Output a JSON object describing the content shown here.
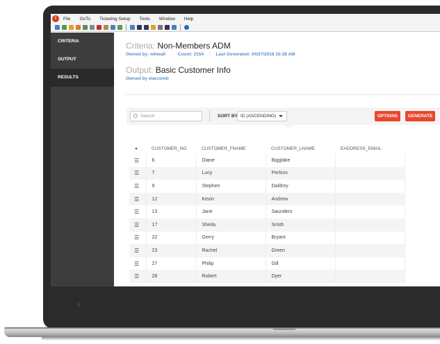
{
  "menu": [
    "File",
    "GoTo",
    "Ticketing Setup",
    "Tools",
    "Window",
    "Help"
  ],
  "logo_letter": "t",
  "sidebar": [
    {
      "label": "CRITERIA"
    },
    {
      "label": "OUTPUT"
    },
    {
      "label": "RESULTS",
      "active": true
    }
  ],
  "criteria": {
    "label": "Criteria:",
    "name": "Non-Members ADM",
    "owner": "Owned by: mhwall",
    "count": "Count: 2154",
    "last_generated": "Last Generated: 04/27/2018 10:28 AM"
  },
  "output": {
    "label": "Output:",
    "name": "Basic Customer Info",
    "owner": "Owned by elarcomb"
  },
  "toolbar": {
    "search_placeholder": "Search",
    "sort_label": "SORT BY",
    "sort_value": "ID (ASCENDING)",
    "options": "OPTIONS",
    "generate": "GENERATE"
  },
  "accent": "#e8462f",
  "table": {
    "headers": [
      "CUSTOMER_NO",
      "CUSTOMER_FNAME",
      "CUSTOMER_LNAME",
      "EADDRESS_EMAIL"
    ],
    "rows": [
      [
        "6",
        "Diane",
        "Bigglake",
        ""
      ],
      [
        "7",
        "Lucy",
        "Perkins",
        ""
      ],
      [
        "9",
        "Stephen",
        "Daldrey",
        ""
      ],
      [
        "12",
        "Kevin",
        "Andrew",
        ""
      ],
      [
        "13",
        "Jane",
        "Saunders",
        ""
      ],
      [
        "17",
        "Sheila",
        "Smith",
        ""
      ],
      [
        "22",
        "Gerry",
        "Bryant",
        ""
      ],
      [
        "23",
        "Rachel",
        "Green",
        ""
      ],
      [
        "27",
        "Philip",
        "Gill",
        ""
      ],
      [
        "28",
        "Robert",
        "Dyer",
        ""
      ]
    ]
  }
}
